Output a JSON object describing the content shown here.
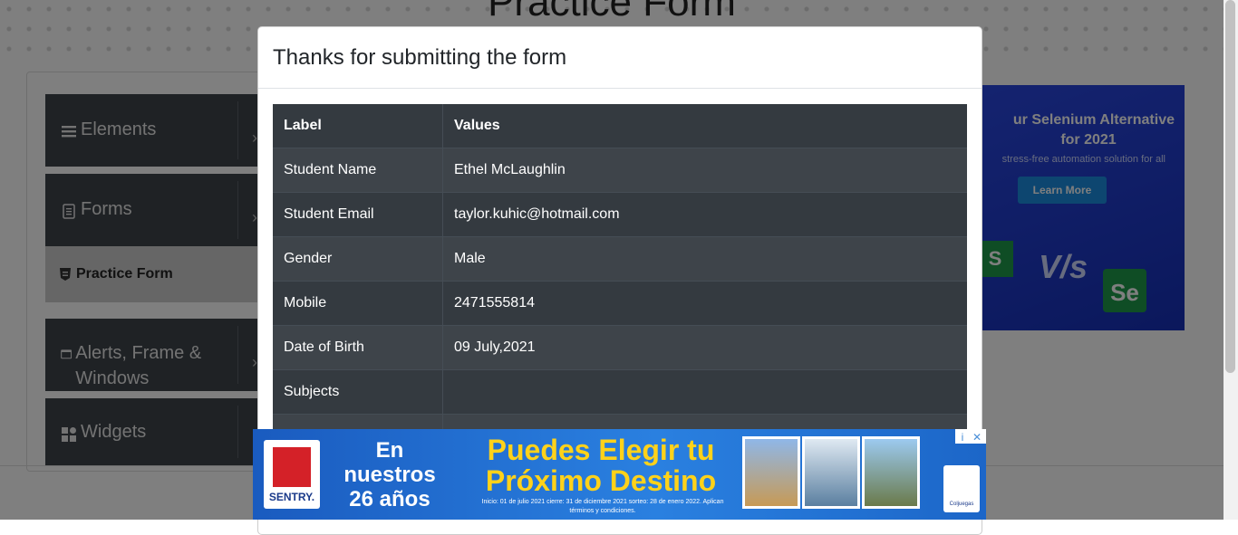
{
  "page": {
    "title": "Practice Form"
  },
  "sidebar": {
    "groups": [
      {
        "label": "Elements",
        "icon": "menu-icon"
      },
      {
        "label": "Forms",
        "icon": "document-icon"
      },
      {
        "label": "Alerts, Frame & Windows",
        "icon": "window-icon"
      },
      {
        "label": "Widgets",
        "icon": "widgets-icon"
      }
    ],
    "active_item": {
      "label": "Practice Form",
      "icon": "html5-icon"
    }
  },
  "ad_right": {
    "line1": "ur Selenium Alternative",
    "line2": "for 2021",
    "tagline": "stress-free automation solution for all",
    "button": "Learn More",
    "vs": "V/s",
    "se_logo": "Se",
    "s_logo": "S"
  },
  "modal": {
    "title": "Thanks for submitting the form",
    "table": {
      "headers": [
        "Label",
        "Values"
      ],
      "rows": [
        {
          "label": "Student Name",
          "value": "Ethel McLaughlin"
        },
        {
          "label": "Student Email",
          "value": "taylor.kuhic@hotmail.com"
        },
        {
          "label": "Gender",
          "value": "Male"
        },
        {
          "label": "Mobile",
          "value": "2471555814"
        },
        {
          "label": "Date of Birth",
          "value": "09 July,2021"
        },
        {
          "label": "Subjects",
          "value": ""
        }
      ]
    }
  },
  "ad_bottom": {
    "brand": "SENTRY.",
    "left_text": "En nuestros 26 años",
    "headline": "Puedes Elegir tu Próximo Destino",
    "fine_print": "Inicio: 01 de julio 2021 cierre: 31 de diciembre 2021 sorteo: 28 de enero 2022. Aplican términos y condiciones.",
    "badge": "Coljuegas",
    "adchoices": "i",
    "close": "✕"
  },
  "colors": {
    "sidebar_bg": "#3e444a",
    "table_dark": "#343a40",
    "table_stripe": "#3e444a",
    "backdrop": "rgba(0,0,0,0.5)",
    "ad_headline": "#ffd21a"
  }
}
